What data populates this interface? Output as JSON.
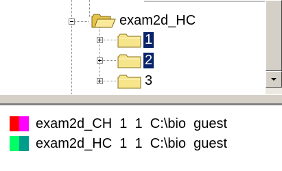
{
  "tree": {
    "parent_folder": "exam2d_HC",
    "children": [
      {
        "label": "1",
        "selected": true
      },
      {
        "label": "2",
        "selected": true
      },
      {
        "label": "3",
        "selected": false
      }
    ]
  },
  "list": {
    "items": [
      {
        "name": "exam2d_CH",
        "col1": "1",
        "col2": "1",
        "path": "C:\\bio",
        "user": "guest",
        "colors": [
          "#ff0000",
          "#ff00ff"
        ]
      },
      {
        "name": "exam2d_HC",
        "col1": "1",
        "col2": "1",
        "path": "C:\\bio",
        "user": "guest",
        "colors": [
          "#00ff66",
          "#009c8c"
        ]
      }
    ]
  },
  "colors": {
    "selection": "#0a246a",
    "folder": "#f7e58c",
    "panel": "#d4d0c8"
  }
}
